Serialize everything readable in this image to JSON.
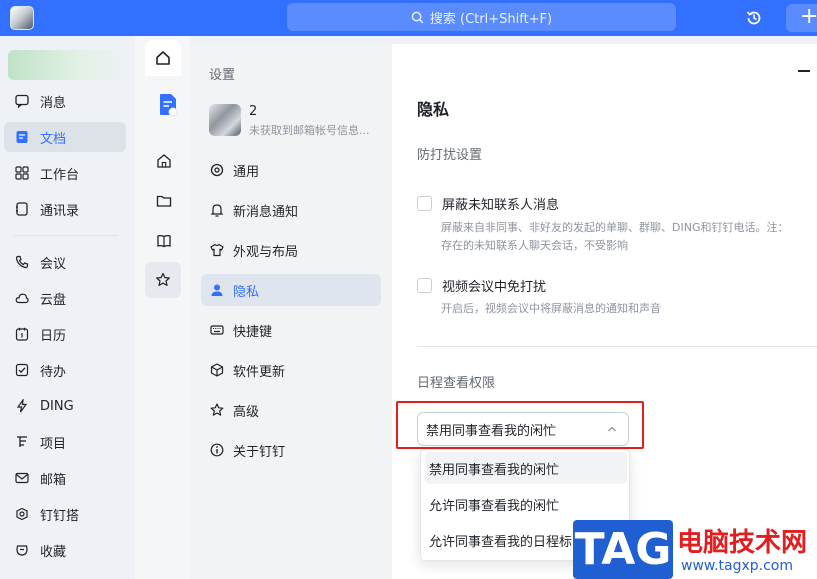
{
  "topbar": {
    "search_placeholder": "搜索 (Ctrl+Shift+F)",
    "plus_label": "+"
  },
  "sidebar": {
    "items": [
      {
        "label": "消息",
        "icon": "message-icon"
      },
      {
        "label": "文档",
        "icon": "doc-icon",
        "active": true
      },
      {
        "label": "工作台",
        "icon": "grid-icon"
      },
      {
        "label": "通讯录",
        "icon": "contacts-icon"
      },
      {
        "label": "会议",
        "icon": "phone-icon"
      },
      {
        "label": "云盘",
        "icon": "cloud-icon"
      },
      {
        "label": "日历",
        "icon": "calendar-icon"
      },
      {
        "label": "待办",
        "icon": "checkbox-icon"
      },
      {
        "label": "DING",
        "icon": "lightning-icon"
      },
      {
        "label": "项目",
        "icon": "project-icon"
      },
      {
        "label": "邮箱",
        "icon": "mail-icon"
      },
      {
        "label": "钉钉搭",
        "icon": "build-icon"
      },
      {
        "label": "收藏",
        "icon": "collect-icon"
      }
    ]
  },
  "settings": {
    "title": "设置",
    "user_name": "2",
    "user_sub": "未获取到邮箱帐号信息...",
    "menu": [
      {
        "label": "通用",
        "icon": "general-icon"
      },
      {
        "label": "新消息通知",
        "icon": "bell-icon"
      },
      {
        "label": "外观与布局",
        "icon": "shirt-icon"
      },
      {
        "label": "隐私",
        "icon": "person-icon",
        "active": true
      },
      {
        "label": "快捷键",
        "icon": "keyboard-icon"
      },
      {
        "label": "软件更新",
        "icon": "cube-icon"
      },
      {
        "label": "高级",
        "icon": "star-icon"
      },
      {
        "label": "关于钉钉",
        "icon": "info-icon"
      }
    ]
  },
  "content": {
    "title": "隐私",
    "section1": "防打扰设置",
    "opt1_label": "屏蔽未知联系人消息",
    "opt1_desc1": "屏蔽来自非同事、非好友的发起的单聊、群聊、DING和钉钉电话。注：",
    "opt1_desc2": "存在的未知联系人聊天会话，不受影响",
    "opt2_label": "视频会议中免打扰",
    "opt2_desc": "开启后，视频会议中将屏蔽消息的通知和声音",
    "section2": "日程查看权限",
    "select_value": "禁用同事查看我的闲忙",
    "options": [
      "禁用同事查看我的闲忙",
      "允许同事查看我的闲忙",
      "允许同事查看我的日程标"
    ]
  },
  "watermark": {
    "tag": "TAG",
    "cn": "电脑技术网",
    "url": "www.tagxp.com"
  },
  "colors": {
    "accent": "#3370ff",
    "highlight": "#e02020"
  }
}
